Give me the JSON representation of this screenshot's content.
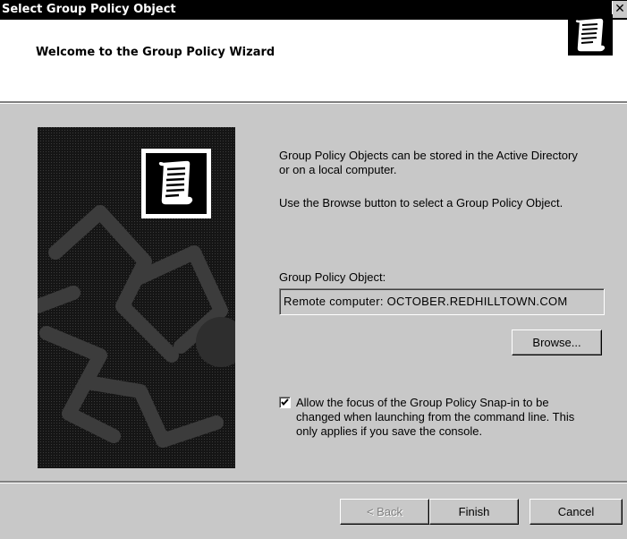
{
  "window": {
    "title": "Select Group Policy Object",
    "close_glyph": "✕"
  },
  "header": {
    "heading": "Welcome to the Group Policy Wizard",
    "icon": "scroll-document-icon"
  },
  "art": {
    "icon": "scroll-document-icon"
  },
  "intro": {
    "line1": "Group Policy Objects can be stored in the Active Directory",
    "line2": "or on a local computer.",
    "line3": "Use the Browse button to select a Group Policy Object."
  },
  "gpo": {
    "label": "Group Policy Object:",
    "value": "Remote computer: OCTOBER.REDHILLTOWN.COM"
  },
  "buttons": {
    "browse": "Browse...",
    "back": "< Back",
    "finish": "Finish",
    "cancel": "Cancel"
  },
  "focus_option": {
    "checked": true,
    "line1": "Allow the focus of the Group Policy Snap-in to be",
    "line2": "changed when launching from the command line.  This",
    "line3": "only applies if you save the console."
  }
}
